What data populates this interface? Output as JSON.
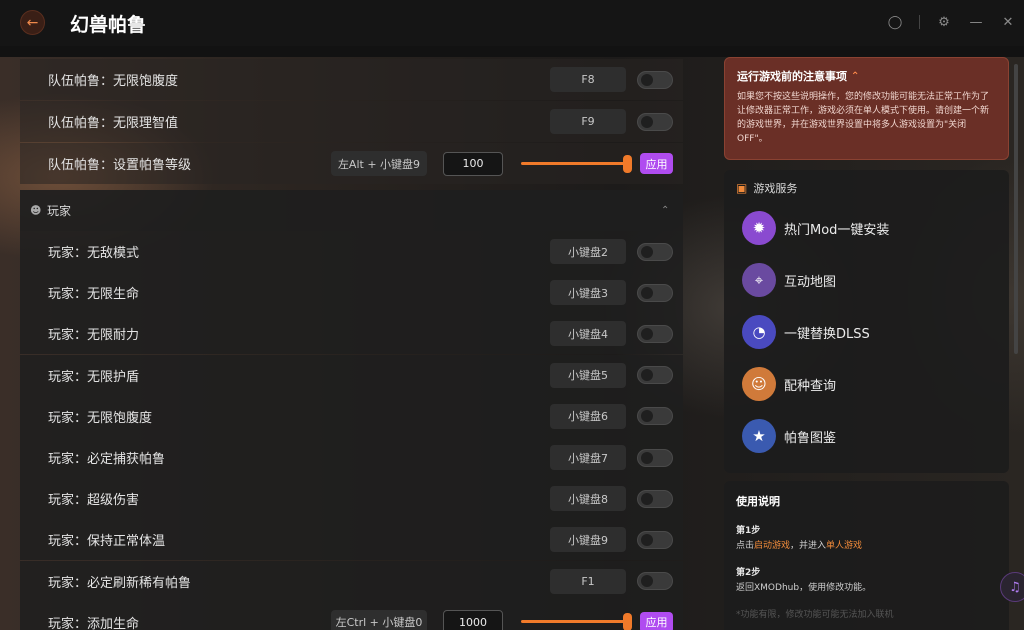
{
  "app": {
    "title": "幻兽帕鲁"
  },
  "window": {
    "back_icon": "arrow-left-icon",
    "controls": [
      "user-icon",
      "settings-icon",
      "minimize-icon",
      "close-icon"
    ]
  },
  "colors": {
    "accent": "#f07a2a",
    "apply": "#b04cf0",
    "notice_bg": "#6a2f26"
  },
  "top_rows": [
    {
      "label": "队伍帕鲁：无限饱腹度",
      "key": "F8",
      "type": "toggle"
    },
    {
      "label": "队伍帕鲁：无限理智值",
      "key": "F9",
      "type": "toggle"
    },
    {
      "label": "队伍帕鲁：设置帕鲁等级",
      "key": "左Alt + 小键盘9",
      "type": "slider",
      "value": "100",
      "slider_fraction": 1.0,
      "apply_label": "应用"
    }
  ],
  "section": {
    "title": "玩家",
    "icon": "people-icon",
    "collapse_icon": "chevron-up-icon"
  },
  "player_rows": [
    {
      "label": "玩家：无敌模式",
      "key": "小键盘2",
      "type": "toggle"
    },
    {
      "label": "玩家：无限生命",
      "key": "小键盘3",
      "type": "toggle"
    },
    {
      "label": "玩家：无限耐力",
      "key": "小键盘4",
      "type": "toggle"
    },
    {
      "label": "玩家：无限护盾",
      "key": "小键盘5",
      "type": "toggle"
    },
    {
      "label": "玩家：无限饱腹度",
      "key": "小键盘6",
      "type": "toggle"
    },
    {
      "label": "玩家：必定捕获帕鲁",
      "key": "小键盘7",
      "type": "toggle"
    },
    {
      "label": "玩家：超级伤害",
      "key": "小键盘8",
      "type": "toggle"
    },
    {
      "label": "玩家：保持正常体温",
      "key": "小键盘9",
      "type": "toggle"
    },
    {
      "label": "玩家：必定刷新稀有帕鲁",
      "key": "F1",
      "type": "toggle"
    },
    {
      "label": "玩家：添加生命",
      "key": "左Ctrl + 小键盘0",
      "type": "slider",
      "value": "1000",
      "slider_fraction": 1.0,
      "apply_label": "应用"
    }
  ],
  "notice": {
    "title": "运行游戏前的注意事项",
    "body": "如果您不按这些说明操作，您的修改功能可能无法正常工作为了让修改器正常工作，游戏必须在单人模式下使用。请创建一个新的游戏世界，并在游戏世界设置中将多人游戏设置为\"关闭OFF\"。"
  },
  "services": {
    "title": "游戏服务",
    "items": [
      {
        "label": "热门Mod一键安装",
        "icon": "mod-icon",
        "color": "#8a4ad0"
      },
      {
        "label": "互动地图",
        "icon": "map-icon",
        "color": "#6a4aa0"
      },
      {
        "label": "一键替换DLSS",
        "icon": "speedometer-icon",
        "color": "#4a4ac0"
      },
      {
        "label": "配种查询",
        "icon": "group-icon",
        "color": "#d07a3a"
      },
      {
        "label": "帕鲁图鉴",
        "icon": "book-icon",
        "color": "#3a5ab0"
      }
    ]
  },
  "usage": {
    "title": "使用说明",
    "step1_title": "第1步",
    "step1_pre": "点击",
    "step1_link1": "启动游戏",
    "step1_mid": "，并进入",
    "step1_link2": "单人游戏",
    "step2_title": "第2步",
    "step2_text": "返回XMODhub，使用修改功能。",
    "step3_faded": "*功能有限，修改功能可能无法加入联机"
  }
}
